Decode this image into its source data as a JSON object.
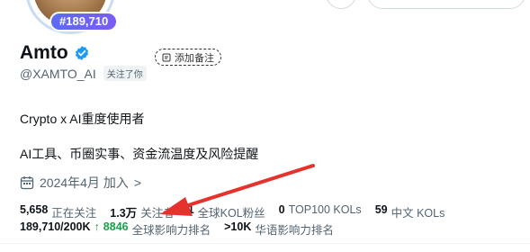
{
  "profile": {
    "rank_badge": "#189,710",
    "display_name": "Amto",
    "note_button": "添加备注",
    "handle": "@XAMTO_AI",
    "follows_you": "关注了你",
    "bio_line_1": "Crypto x AI重度使用者",
    "bio_line_2": "AI工具、币圈实事、资金流温度及风险提醒",
    "joined": "2024年4月 加入",
    "joined_chevron": ">"
  },
  "stats": {
    "following_num": "5,658",
    "following_lbl": "正在关注",
    "followers_num": "1.3万",
    "followers_lbl": "关注者",
    "kol_num": "1",
    "kol_lbl": "全球KOL粉丝",
    "top100_num": "0",
    "top100_lbl": "TOP100 KOLs",
    "cn_num": "59",
    "cn_lbl": "中文 KOLs"
  },
  "ranking": {
    "rank_num": "189,710/200K",
    "change_arrow": "↑",
    "change_value": "8846",
    "global_lbl": "全球影响力排名",
    "cn_num": ">10K",
    "cn_lbl": "华语影响力排名"
  },
  "colors": {
    "verified": "#1d9bf0",
    "annotation_arrow": "#e5322d",
    "rank_badge": "#5b6cf0",
    "rank_up": "#17a34a"
  },
  "icons": [
    "verified-icon",
    "note-icon",
    "calendar-icon",
    "chevron-right-icon",
    "annotation-arrow"
  ]
}
